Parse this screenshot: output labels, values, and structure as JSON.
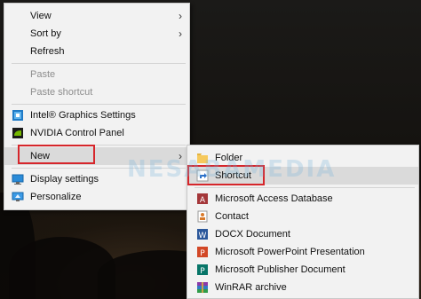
{
  "context_menu": {
    "items": [
      {
        "label": "View",
        "arrow": true
      },
      {
        "label": "Sort by",
        "arrow": true
      },
      {
        "label": "Refresh"
      },
      {
        "label": "Paste",
        "disabled": true
      },
      {
        "label": "Paste shortcut",
        "disabled": true
      },
      {
        "label": "Intel® Graphics Settings",
        "icon": "intel-graphics-icon"
      },
      {
        "label": "NVIDIA Control Panel",
        "icon": "nvidia-icon"
      },
      {
        "label": "New",
        "arrow": true,
        "highlighted": true
      },
      {
        "label": "Display settings",
        "icon": "display-icon"
      },
      {
        "label": "Personalize",
        "icon": "personalize-icon"
      }
    ]
  },
  "new_submenu": {
    "items": [
      {
        "label": "Folder",
        "icon": "folder-icon"
      },
      {
        "label": "Shortcut",
        "icon": "shortcut-icon",
        "highlighted": true
      },
      {
        "label": "Microsoft Access Database",
        "icon": "access-icon"
      },
      {
        "label": "Contact",
        "icon": "contact-icon"
      },
      {
        "label": "DOCX Document",
        "icon": "word-icon"
      },
      {
        "label": "Microsoft PowerPoint Presentation",
        "icon": "powerpoint-icon"
      },
      {
        "label": "Microsoft Publisher Document",
        "icon": "publisher-icon"
      },
      {
        "label": "WinRAR archive",
        "icon": "winrar-icon"
      }
    ]
  },
  "watermark": "NESABAMEDIA",
  "colors": {
    "highlight_border": "#d6262b",
    "menu_bg": "#f2f2f2"
  }
}
